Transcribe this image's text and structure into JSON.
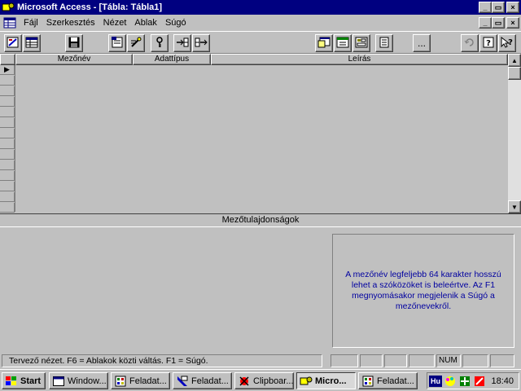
{
  "window": {
    "title": "Microsoft Access - [Tábla: Tábla1]",
    "controls": {
      "minimize": "_",
      "restore": "▭",
      "close": "×"
    }
  },
  "menu": {
    "items": [
      {
        "label": "Fájl"
      },
      {
        "label": "Szerkesztés"
      },
      {
        "label": "Nézet"
      },
      {
        "label": "Ablak"
      },
      {
        "label": "Súgó"
      }
    ]
  },
  "toolbar": {
    "more_label": "..."
  },
  "grid": {
    "columns": [
      "Mezőnév",
      "Adattípus",
      "Leírás"
    ],
    "row_indicator": "▶"
  },
  "properties": {
    "header": "Mezőtulajdonságok",
    "help_text": "A mezőnév legfeljebb 64 karakter hosszú lehet a szóközöket is beleértve. Az F1 megnyomásakor megjelenik a Súgó a mezőnevekről."
  },
  "statusbar": {
    "text": "Tervező nézet. F6 = Ablakok közti váltás. F1 = Súgó.",
    "num": "NUM"
  },
  "taskbar": {
    "start": "Start",
    "tasks": [
      {
        "label": "Window..."
      },
      {
        "label": "Feladat..."
      },
      {
        "label": "Feladat..."
      },
      {
        "label": "Clipboar..."
      },
      {
        "label": "Micro..."
      },
      {
        "label": "Feladat..."
      }
    ],
    "tray_lang": "Hu",
    "clock": "18:40"
  },
  "colors": {
    "titlebar": "#000080",
    "help_text": "#0000a0",
    "face": "#c0c0c0"
  }
}
